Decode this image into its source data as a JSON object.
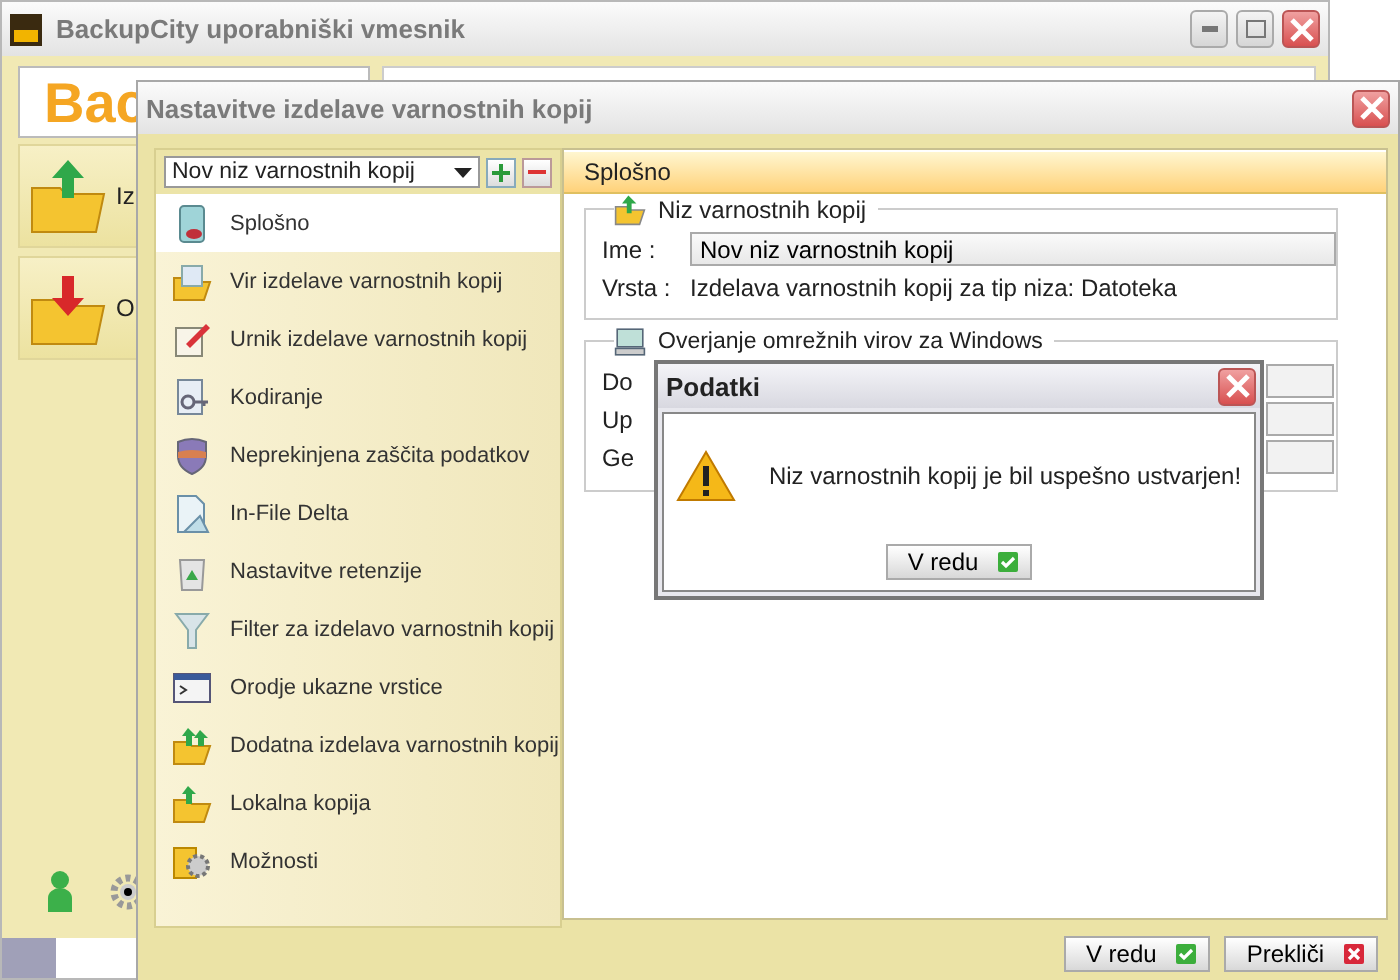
{
  "main_window": {
    "title": "BackupCity uporabniški vmesnik",
    "logo": "Bac",
    "nav": [
      {
        "label": "Iz"
      },
      {
        "label": "O"
      }
    ]
  },
  "settings_dialog": {
    "title": "Nastavitve izdelave varnostnih kopij",
    "backup_set_select": {
      "value": "Nov niz varnostnih kopij"
    },
    "sidebar": {
      "items": [
        {
          "label": "Splošno",
          "selected": true
        },
        {
          "label": "Vir izdelave varnostnih kopij",
          "selected": false
        },
        {
          "label": "Urnik izdelave varnostnih kopij",
          "selected": false
        },
        {
          "label": "Kodiranje",
          "selected": false
        },
        {
          "label": "Neprekinjena zaščita podatkov",
          "selected": false
        },
        {
          "label": "In-File Delta",
          "selected": false
        },
        {
          "label": "Nastavitve retenzije",
          "selected": false
        },
        {
          "label": "Filter za izdelavo varnostnih kopij",
          "selected": false
        },
        {
          "label": "Orodje ukazne vrstice",
          "selected": false
        },
        {
          "label": "Dodatna izdelava varnostnih kopij",
          "selected": false
        },
        {
          "label": "Lokalna kopija",
          "selected": false
        },
        {
          "label": "Možnosti",
          "selected": false
        }
      ]
    },
    "section_title": "Splošno",
    "set_group": {
      "title": "Niz varnostnih kopij",
      "name_label": "Ime :",
      "name_value": "Nov niz varnostnih kopij",
      "type_label": "Vrsta :",
      "type_value": "Izdelava varnostnih kopij za tip niza: Datoteka"
    },
    "windows_group": {
      "title": "Overjanje omrežnih virov za Windows",
      "labels": [
        "Do",
        "Up",
        "Ge"
      ]
    },
    "buttons": [
      {
        "label": "V redu",
        "kind": "ok"
      },
      {
        "label": "Prekliči",
        "kind": "cancel"
      }
    ]
  },
  "message_dialog": {
    "title": "Podatki",
    "message": "Niz varnostnih kopij je bil uspešno ustvarjen!",
    "button": "V redu"
  }
}
